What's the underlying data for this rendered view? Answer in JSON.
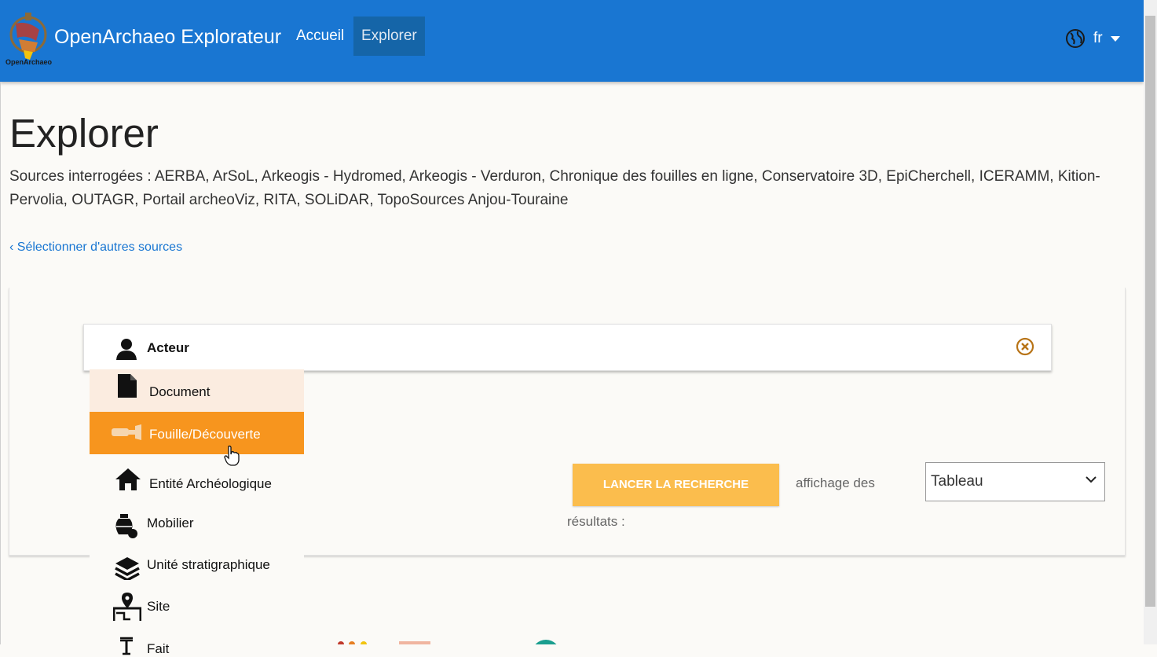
{
  "navbar": {
    "logo_caption": "OpenArchaeo",
    "brand": "OpenArchaeo Explorateur",
    "links": [
      {
        "label": "Accueil"
      },
      {
        "label": "Explorer"
      }
    ],
    "language": "fr"
  },
  "page": {
    "title": "Explorer",
    "sources_text": "Sources interrogées : AERBA, ArSoL, Arkeogis - Hydromed, Arkeogis - Verduron, Chronique des fouilles en ligne, Conservatoire 3D, EpiCherchell, ICERAMM, Kition-Pervolia, OUTAGR, Portail archeoViz, RITA, SOLiDAR, TopoSources Anjou-Touraine",
    "back_link": "Sélectionner d'autres sources"
  },
  "search": {
    "selected": "Acteur",
    "options": [
      {
        "label": "Document",
        "icon": "document-icon"
      },
      {
        "label": "Fouille/Découverte",
        "icon": "trowel-icon"
      },
      {
        "label": "Entité Archéologique",
        "icon": "house-icon"
      },
      {
        "label": "Mobilier",
        "icon": "pottery-icon"
      },
      {
        "label": "Unité stratigraphique",
        "icon": "layers-icon"
      },
      {
        "label": "Site",
        "icon": "map-pin-icon"
      },
      {
        "label": "Fait",
        "icon": "fact-icon"
      }
    ],
    "button_label": "LANCER LA RECHERCHE",
    "results_label_part1": "affichage des",
    "results_label_part2": "résultats :",
    "view_value": "Tableau"
  },
  "colors": {
    "navbar": "#1976d2",
    "accent_orange": "#f7951e",
    "button": "#fbbd4d",
    "clear_icon": "#b87417"
  }
}
